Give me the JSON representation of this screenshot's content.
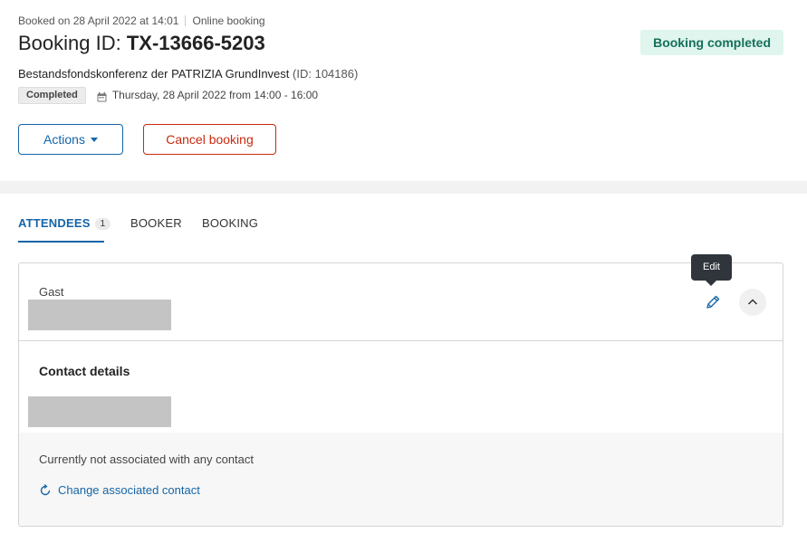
{
  "header": {
    "booked_on": "Booked on 28 April 2022 at 14:01",
    "channel": "Online booking",
    "title_prefix": "Booking ID: ",
    "booking_id": "TX-13666-5203",
    "status_badge": "Booking completed",
    "event_name": "Bestandsfondskonferenz der PATRIZIA GrundInvest",
    "event_id": "(ID: 104186)",
    "state_pill": "Completed",
    "date_text": "Thursday, 28 April 2022 from 14:00 - 16:00",
    "actions_label": "Actions",
    "cancel_label": "Cancel booking"
  },
  "tabs": [
    {
      "label": "ATTENDEES",
      "count": "1"
    },
    {
      "label": "BOOKER"
    },
    {
      "label": "BOOKING"
    }
  ],
  "attendee": {
    "type_label": "Gast",
    "contact_title": "Contact details",
    "association_text": "Currently not associated with any contact",
    "change_link": "Change associated contact",
    "edit_tooltip": "Edit"
  },
  "colors": {
    "accent": "#1565a8",
    "danger": "#c82a10",
    "success_bg": "#dff5ee",
    "success_text": "#16705a"
  },
  "icons": [
    "calendar-icon",
    "pencil-icon",
    "chevron-up-icon",
    "refresh-icon",
    "caret-down-icon"
  ]
}
